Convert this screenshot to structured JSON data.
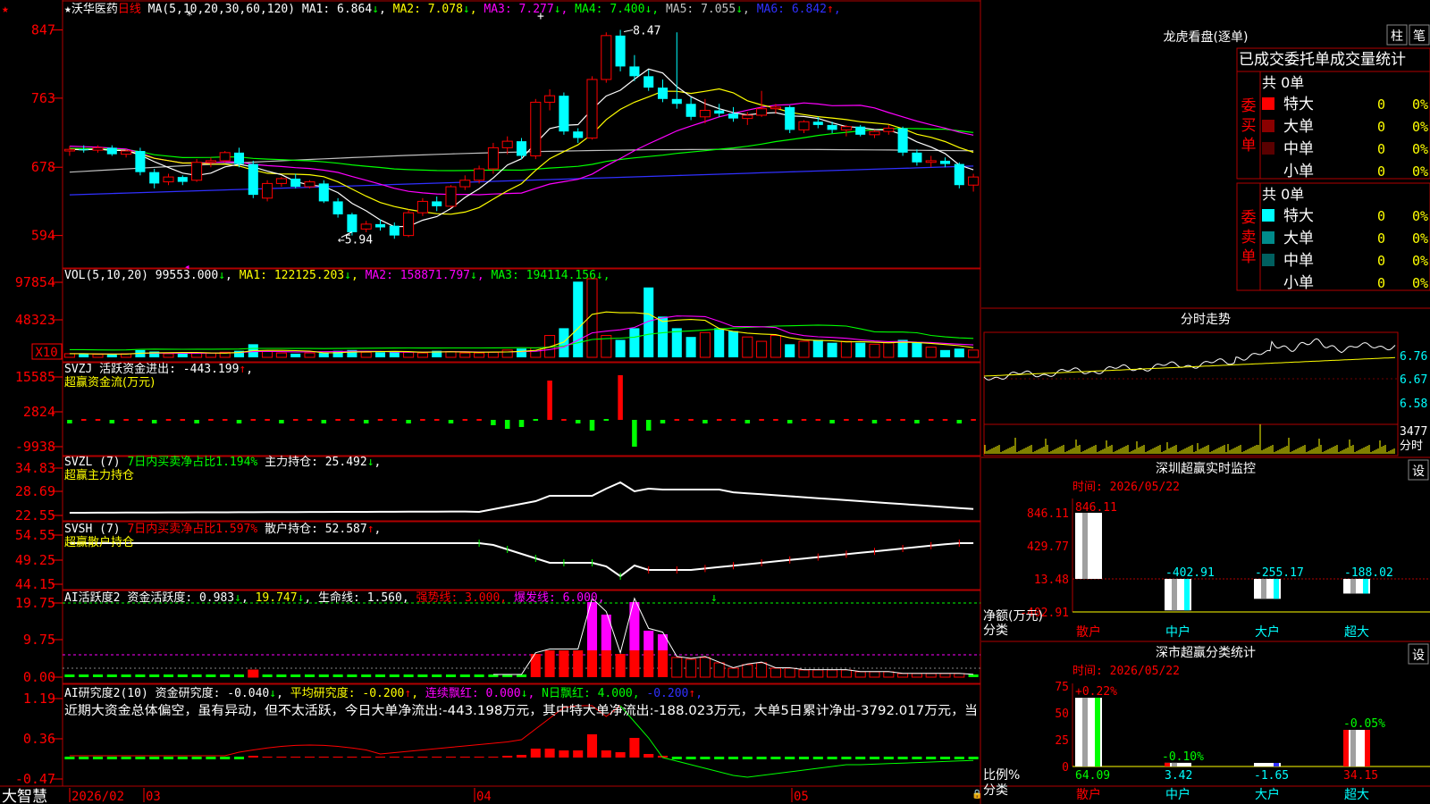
{
  "stock": {
    "name": "沃华医药",
    "period": "日线",
    "star": "★"
  },
  "ma": {
    "prefix": "MA(5,10,20,30,60,120)",
    "items": [
      {
        "label": "MA1:",
        "value": "6.864",
        "arrow": "↓",
        "color": "#ffffff"
      },
      {
        "label": "MA2:",
        "value": "7.078",
        "arrow": "↓",
        "color": "#ffff00"
      },
      {
        "label": "MA3:",
        "value": "7.277",
        "arrow": "↓",
        "color": "#ff00ff"
      },
      {
        "label": "MA4:",
        "value": "7.400",
        "arrow": "↓",
        "color": "#00ff00"
      },
      {
        "label": "MA5:",
        "value": "7.055",
        "arrow": "↓",
        "color": "#c0c0c0"
      },
      {
        "label": "MA6:",
        "value": "6.842",
        "arrow": "↑",
        "color": "#3030ff"
      }
    ]
  },
  "price_axis": [
    "847",
    "763",
    "678",
    "594"
  ],
  "price_marks": {
    "high": "8.47",
    "low": "5.94"
  },
  "vol": {
    "prefix": "VOL(5,10,20)",
    "value": "99553.000",
    "arrow": "↓",
    "items": [
      {
        "label": "MA1:",
        "value": "122125.203",
        "arrow": "↓",
        "color": "#ffff00"
      },
      {
        "label": "MA2:",
        "value": "158871.797",
        "arrow": "↓",
        "color": "#ff00ff"
      },
      {
        "label": "MA3:",
        "value": "194114.156",
        "arrow": "↓",
        "color": "#00ff00"
      }
    ],
    "axis": [
      "97854",
      "48323"
    ],
    "unit": "X10"
  },
  "svzj": {
    "prefix": "SVZJ",
    "label": "活跃资金进出:",
    "value": "-443.199",
    "arrow": "↑",
    "comma": ",",
    "sub": "超赢资金流(万元)",
    "axis": [
      "15585",
      "2824",
      "-9938"
    ]
  },
  "svzl": {
    "prefix": "SVZL (7)",
    "label": "7日内买卖净占比1.194%",
    "label2": "主力持仓:",
    "value": "25.492",
    "arrow": "↓",
    "comma": ",",
    "sub": "超赢主力持仓",
    "axis": [
      "34.83",
      "28.69",
      "22.55"
    ]
  },
  "svsh": {
    "prefix": "SVSH (7)",
    "label": "7日内买卖净占比1.597%",
    "label2": "散户持仓:",
    "value": "52.587",
    "arrow": "↑",
    "comma": ",",
    "sub": "超赢散户持仓",
    "axis": [
      "54.55",
      "49.25",
      "44.15"
    ]
  },
  "ai2": {
    "prefix": "AI活跃度2",
    "label": "资金活跃度:",
    "value": "0.983",
    "arrow": "↓",
    "comma": ",",
    "value2": "19.747",
    "arrow2": "↓",
    "comma2": ",",
    "label3": "生命线:",
    "value3": "1.560",
    "comma3": ",",
    "label4": "强势线:",
    "value4": "3.000",
    "comma4": ",",
    "label5": "爆发线:",
    "value5": "6.000",
    "comma5": ",",
    "axis": [
      "19.75",
      "9.75",
      "0.00"
    ]
  },
  "ai3": {
    "prefix": "AI研究度2(10)",
    "label": "资金研究度:",
    "value": "-0.040",
    "arrow": "↓",
    "comma": ",",
    "label2": "平均研究度:",
    "value2": "-0.200",
    "arrow2": "↑",
    "comma2": ",",
    "label3": "连续飘红:",
    "value3": "0.000",
    "arrow3": "↓",
    "comma3": ",",
    "label4": "N日飘红:",
    "value4": "4.000",
    "comma4": ",",
    "value5": "-0.200",
    "arrow5": "↑",
    "comma5": ",",
    "commentary": "近期大资金总体偏空，虽有异动，但不太活跃，今日大单净流出:-443.198万元，其中特大单净流出:-188.023万元，大单5日累计净出-3792.017万元，当",
    "axis": [
      "1.19",
      "0.36",
      "-0.47"
    ]
  },
  "timeline": {
    "brand": "大智慧",
    "labels": [
      "2026/02",
      "03",
      "04",
      "05"
    ]
  },
  "lhb": {
    "title": "龙虎看盘(逐单)",
    "btn1": "柱",
    "btn2": "笔",
    "header": "已成交委托单成交量统计",
    "buy": {
      "side": "委买单",
      "total": "共 0单",
      "rows": [
        {
          "name": "特大",
          "count": "0",
          "pct": "0%",
          "color": "#ff0000"
        },
        {
          "name": "大单",
          "count": "0",
          "pct": "0%",
          "color": "#8b0000"
        },
        {
          "name": "中单",
          "count": "0",
          "pct": "0%",
          "color": "#5a0000"
        },
        {
          "name": "小单",
          "count": "0",
          "pct": "0%",
          "color": ""
        }
      ]
    },
    "sell": {
      "side": "委卖单",
      "total": "共 0单",
      "rows": [
        {
          "name": "特大",
          "count": "0",
          "pct": "0%",
          "color": "#00ffff"
        },
        {
          "name": "大单",
          "count": "0",
          "pct": "0%",
          "color": "#008b8b"
        },
        {
          "name": "中单",
          "count": "0",
          "pct": "0%",
          "color": "#005f5f"
        },
        {
          "name": "小单",
          "count": "0",
          "pct": "0%",
          "color": ""
        }
      ]
    }
  },
  "intraday": {
    "title": "分时走势",
    "axis": [
      "6.76",
      "6.67",
      "6.58"
    ],
    "vol_label": "3477",
    "vol_unit": "分时"
  },
  "sz_monitor": {
    "title": "深圳超赢实时监控",
    "btn": "设",
    "time_label": "时间: 2026/05/22",
    "axis": [
      "846.11",
      "429.77",
      "13.48",
      "-402.91"
    ],
    "ylabel": "净额(万元)",
    "xlabel": "分类",
    "categories": [
      "散户",
      "中户",
      "大户",
      "超大"
    ],
    "values": [
      "846.11",
      "-402.91",
      "-255.17",
      "-188.02"
    ]
  },
  "sz_class": {
    "title": "深市超赢分类统计",
    "btn": "设",
    "time_label": "时间: 2026/05/22",
    "axis": [
      "75",
      "50",
      "25",
      "0"
    ],
    "ylabel": "比例%",
    "xlabel": "分类",
    "categories": [
      "散户",
      "中户",
      "大户",
      "超大"
    ],
    "top_labels": [
      "+0.22%",
      "-0.10%",
      "",
      "-0.05%"
    ],
    "bottom_values": [
      "64.09",
      "3.42",
      "-1.65",
      "34.15"
    ]
  },
  "chart_data": [
    {
      "type": "candlestick",
      "title": "沃华医药 日线",
      "ylim": [
        5.94,
        8.47
      ],
      "ohlc": [
        [
          6.98,
          7.04,
          6.92,
          7.0
        ],
        [
          7.0,
          7.05,
          6.96,
          6.99
        ],
        [
          6.99,
          7.05,
          6.96,
          7.02
        ],
        [
          7.02,
          7.05,
          6.92,
          6.94
        ],
        [
          6.94,
          7.0,
          6.9,
          6.98
        ],
        [
          6.98,
          7.02,
          6.68,
          6.72
        ],
        [
          6.72,
          6.76,
          6.52,
          6.58
        ],
        [
          6.6,
          6.7,
          6.56,
          6.66
        ],
        [
          6.66,
          6.68,
          6.56,
          6.6
        ],
        [
          6.62,
          6.88,
          6.6,
          6.84
        ],
        [
          6.84,
          6.9,
          6.78,
          6.86
        ],
        [
          6.86,
          6.98,
          6.84,
          6.96
        ],
        [
          6.96,
          7.02,
          6.78,
          6.82
        ],
        [
          6.82,
          6.86,
          6.4,
          6.44
        ],
        [
          6.4,
          6.62,
          6.36,
          6.58
        ],
        [
          6.58,
          6.66,
          6.54,
          6.64
        ],
        [
          6.64,
          6.7,
          6.52,
          6.54
        ],
        [
          6.54,
          6.62,
          6.52,
          6.6
        ],
        [
          6.58,
          6.62,
          6.34,
          6.36
        ],
        [
          6.36,
          6.4,
          6.16,
          6.2
        ],
        [
          6.2,
          6.22,
          5.94,
          5.98
        ],
        [
          6.02,
          6.12,
          5.98,
          6.08
        ],
        [
          6.08,
          6.14,
          6.0,
          6.04
        ],
        [
          6.06,
          6.1,
          5.9,
          5.94
        ],
        [
          5.94,
          6.26,
          5.92,
          6.22
        ],
        [
          6.22,
          6.4,
          6.18,
          6.36
        ],
        [
          6.36,
          6.42,
          6.24,
          6.3
        ],
        [
          6.3,
          6.56,
          6.28,
          6.54
        ],
        [
          6.54,
          6.68,
          6.5,
          6.62
        ],
        [
          6.62,
          6.8,
          6.58,
          6.76
        ],
        [
          6.76,
          7.08,
          6.7,
          7.02
        ],
        [
          7.02,
          7.16,
          6.94,
          7.1
        ],
        [
          7.1,
          7.14,
          6.88,
          6.92
        ],
        [
          6.92,
          7.62,
          6.88,
          7.58
        ],
        [
          7.58,
          7.74,
          7.48,
          7.66
        ],
        [
          7.66,
          7.7,
          7.18,
          7.22
        ],
        [
          7.22,
          7.26,
          7.08,
          7.14
        ],
        [
          7.14,
          7.9,
          7.12,
          7.86
        ],
        [
          7.86,
          8.44,
          7.82,
          8.4
        ],
        [
          8.4,
          8.47,
          7.96,
          8.02
        ],
        [
          8.02,
          8.16,
          7.84,
          7.9
        ],
        [
          7.9,
          7.98,
          7.72,
          7.76
        ],
        [
          7.76,
          7.86,
          7.58,
          7.62
        ],
        [
          7.62,
          8.44,
          7.5,
          7.56
        ],
        [
          7.56,
          7.64,
          7.36,
          7.4
        ],
        [
          7.4,
          7.62,
          7.32,
          7.48
        ],
        [
          7.48,
          7.56,
          7.4,
          7.44
        ],
        [
          7.44,
          7.52,
          7.34,
          7.38
        ],
        [
          7.38,
          7.46,
          7.3,
          7.42
        ],
        [
          7.42,
          7.72,
          7.4,
          7.5
        ],
        [
          7.5,
          7.56,
          7.44,
          7.52
        ],
        [
          7.52,
          7.54,
          7.2,
          7.24
        ],
        [
          7.24,
          7.36,
          7.2,
          7.34
        ],
        [
          7.34,
          7.4,
          7.26,
          7.3
        ],
        [
          7.3,
          7.34,
          7.2,
          7.24
        ],
        [
          7.24,
          7.3,
          7.16,
          7.28
        ],
        [
          7.28,
          7.3,
          7.16,
          7.18
        ],
        [
          7.18,
          7.24,
          7.14,
          7.22
        ],
        [
          7.22,
          7.3,
          7.18,
          7.26
        ],
        [
          7.26,
          7.28,
          6.92,
          6.96
        ],
        [
          6.96,
          7.0,
          6.8,
          6.84
        ],
        [
          6.84,
          6.92,
          6.78,
          6.86
        ],
        [
          6.86,
          6.9,
          6.78,
          6.82
        ],
        [
          6.82,
          6.84,
          6.52,
          6.56
        ],
        [
          6.56,
          6.7,
          6.48,
          6.66
        ]
      ]
    },
    {
      "type": "bar",
      "title": "VOL(5,10,20)",
      "values": [
        5,
        5,
        4,
        4,
        5,
        10,
        8,
        5,
        5,
        6,
        6,
        7,
        9,
        18,
        8,
        6,
        5,
        6,
        6,
        9,
        10,
        7,
        7,
        8,
        7,
        6,
        9,
        8,
        6,
        6,
        7,
        10,
        12,
        13,
        30,
        40,
        104,
        108,
        30,
        24,
        40,
        96,
        56,
        40,
        28,
        34,
        40,
        36,
        28,
        22,
        30,
        18,
        22,
        24,
        20,
        22,
        20,
        18,
        20,
        24,
        20,
        14,
        10,
        12,
        10
      ]
    },
    {
      "type": "bar",
      "title": "SVZJ 活跃资金进出",
      "ylim": [
        -9938,
        15585
      ]
    },
    {
      "type": "line",
      "title": "SVZL 主力持仓",
      "ylim": [
        22.55,
        34.83
      ]
    },
    {
      "type": "line",
      "title": "SVSH 散户持仓",
      "ylim": [
        44.15,
        54.55
      ]
    },
    {
      "type": "bar",
      "title": "AI活跃度2",
      "ylim": [
        0,
        19.75
      ]
    },
    {
      "type": "bar",
      "title": "AI研究度2(10)",
      "ylim": [
        -0.47,
        1.19
      ]
    },
    {
      "type": "line",
      "title": "分时走势",
      "ylim": [
        6.58,
        6.76
      ]
    },
    {
      "type": "bar",
      "title": "深圳超赢实时监控",
      "categories": [
        "散户",
        "中户",
        "大户",
        "超大"
      ],
      "values": [
        846.11,
        -402.91,
        -255.17,
        -188.02
      ],
      "ylabel": "净额(万元)",
      "xlabel": "分类"
    },
    {
      "type": "bar",
      "title": "深市超赢分类统计",
      "categories": [
        "散户",
        "中户",
        "大户",
        "超大"
      ],
      "values": [
        64.09,
        3.42,
        -1.65,
        34.15
      ],
      "ylabel": "比例%",
      "xlabel": "分类",
      "ylim": [
        0,
        75
      ]
    }
  ]
}
